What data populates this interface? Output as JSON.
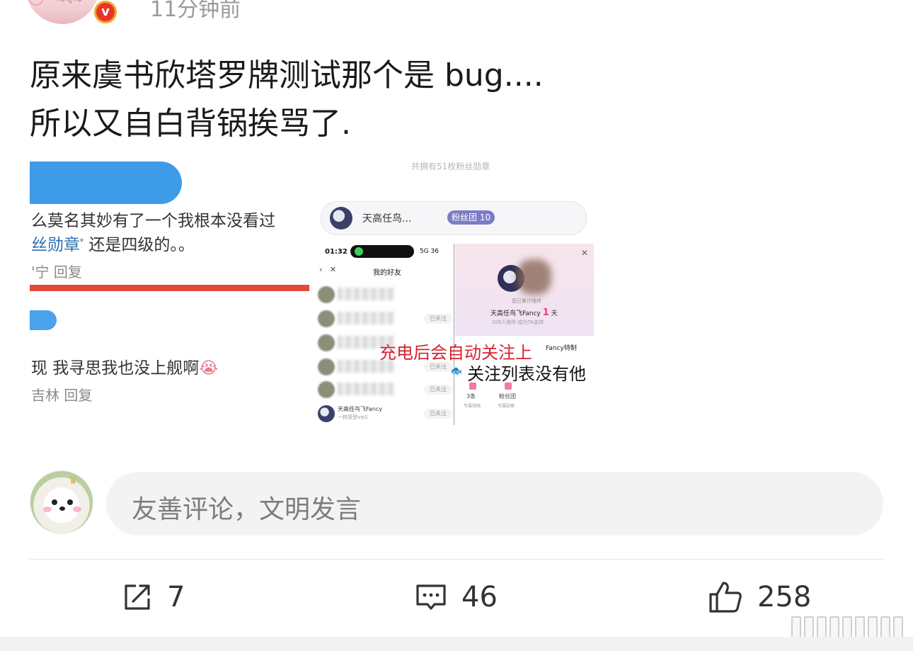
{
  "post": {
    "time": "11分钟前",
    "text_line1": "原来虞书欣塔罗牌测试那个是 bug....",
    "text_line2": "所以又自白背锅挨骂了."
  },
  "screenshot_left": {
    "line1": "么莫名其妙有了一个我根本没看过",
    "line2_link": "丝勋章",
    "line2_rest": "还是四级的。。",
    "meta1": "'宁 回复",
    "line3": "现 我寻思我也没上舰啊",
    "meta2": "吉林 回复"
  },
  "screenshot_right": {
    "top_faint": "共拥有51枚粉丝勋章",
    "fan_name": "天高任鸟...",
    "fan_badge": "粉丝团 10",
    "phone_time": "01:32",
    "phone_signal": "5G 36",
    "phone_title": "我的好友",
    "followed_label": "已关注",
    "friend_name": "天高任鸟飞Fancy",
    "friend_sub": "一枚感受vip1",
    "card_sub": "您已累计陪伴",
    "card_name": "天高任鸟飞Fancy",
    "card_days": "1",
    "card_days_unit": "天",
    "card_small": "208人陪伴·成为TA支持",
    "fancy_tag": "Fancy特制",
    "stat1_value": "3条",
    "stat1_label": "专属视频",
    "stat2_value": "粉丝团",
    "stat2_label": "专属勋章",
    "overlay_red": "充电后会自动关注上",
    "overlay_black": "关注列表没有他"
  },
  "comment": {
    "placeholder": "友善评论，文明发言"
  },
  "actions": {
    "share_count": "7",
    "comment_count": "46",
    "like_count": "258"
  },
  "colors": {
    "accent_red": "#d5232e",
    "link_blue": "#2f6fb1",
    "verified_orange": "#f5a623"
  }
}
